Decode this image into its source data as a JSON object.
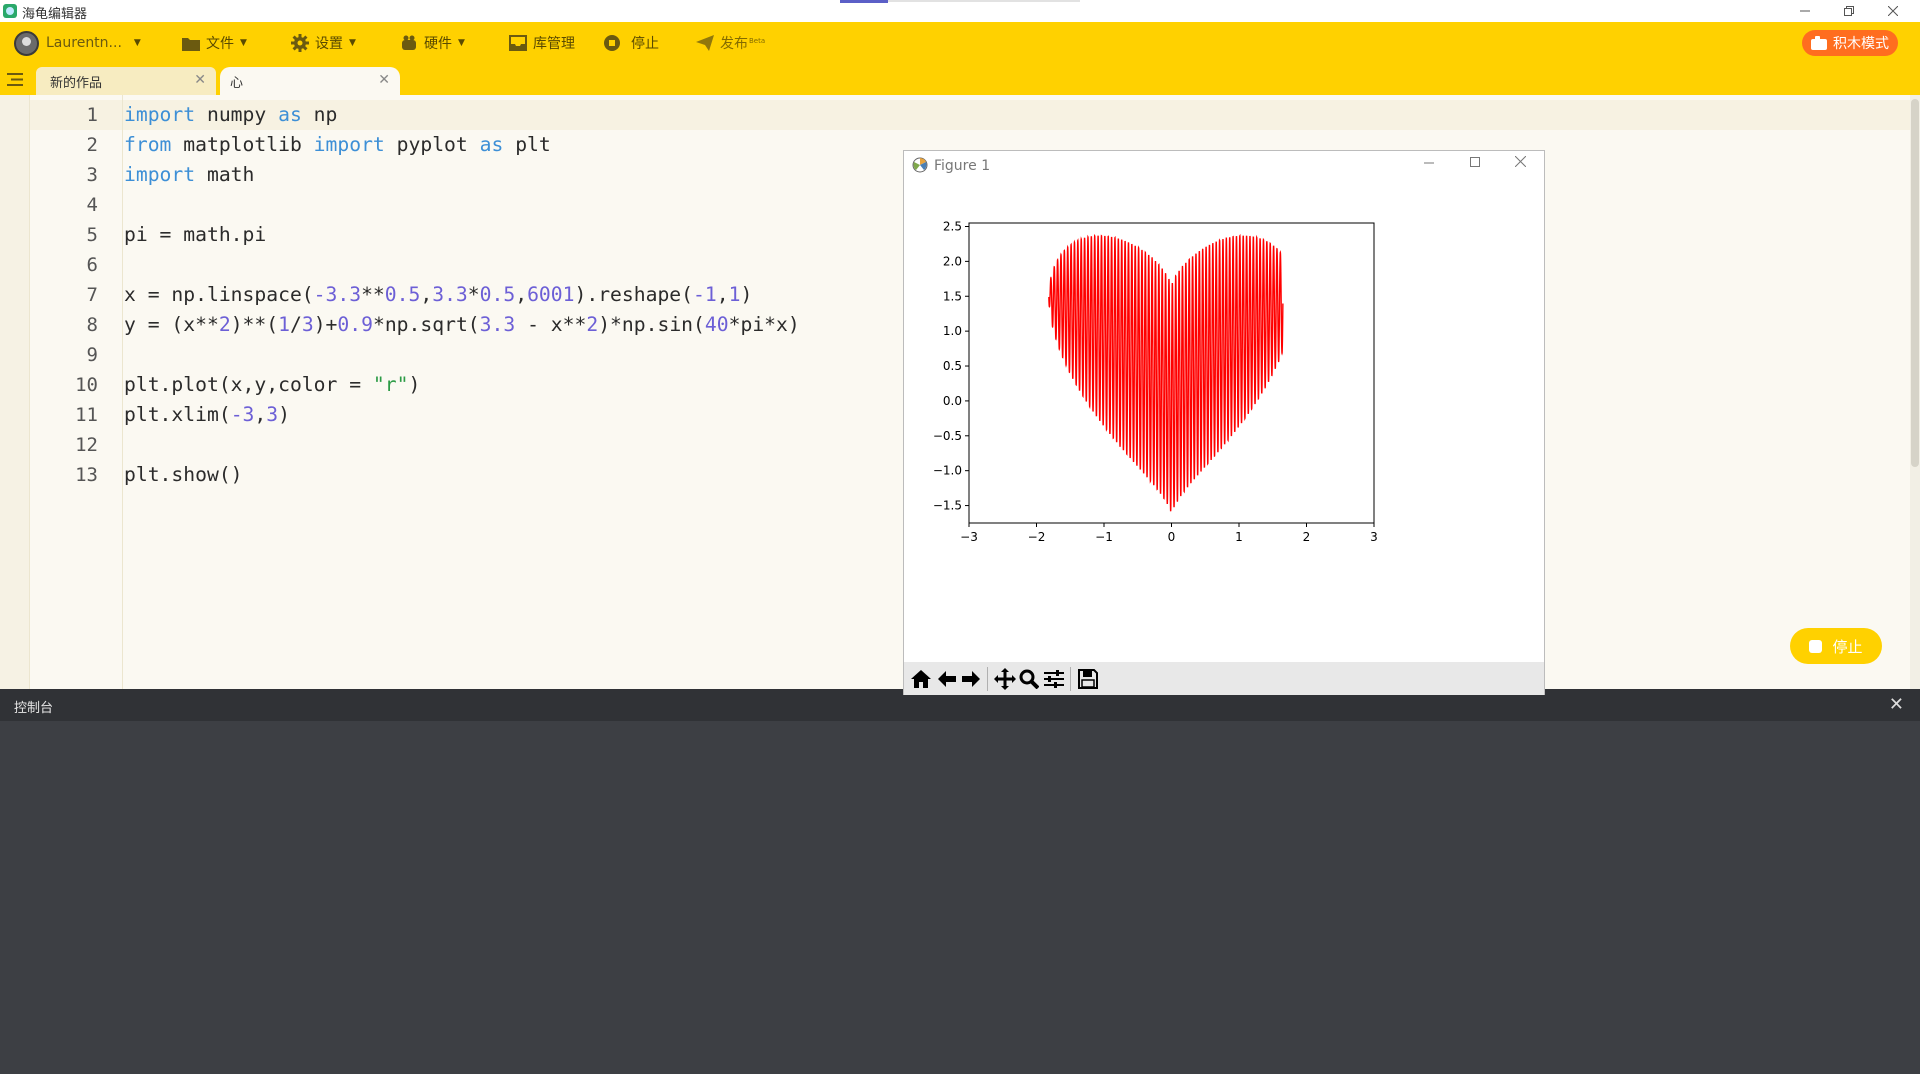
{
  "window": {
    "title": "海龟编辑器",
    "controls": [
      "minimize",
      "restore",
      "close"
    ]
  },
  "toolbar": {
    "user_name": "Laurentn...",
    "file_label": "文件",
    "settings_label": "设置",
    "hardware_label": "硬件",
    "library_label": "库管理",
    "stop_label": "停止",
    "publish_label": "发布",
    "publish_badge": "Beta",
    "block_mode_label": "积木模式",
    "accent_color": "#ffd100",
    "block_mode_color": "#ff6d1f"
  },
  "tabs": [
    {
      "label": "新的作品"
    },
    {
      "label": "心"
    }
  ],
  "editor": {
    "line_numbers": [
      "1",
      "2",
      "3",
      "4",
      "5",
      "6",
      "7",
      "8",
      "9",
      "10",
      "11",
      "12",
      "13"
    ],
    "lines": [
      [
        {
          "t": "import",
          "c": "kw"
        },
        {
          "t": " numpy "
        },
        {
          "t": "as",
          "c": "kw"
        },
        {
          "t": " np"
        }
      ],
      [
        {
          "t": "from",
          "c": "kw"
        },
        {
          "t": " matplotlib "
        },
        {
          "t": "import",
          "c": "kw"
        },
        {
          "t": " pyplot "
        },
        {
          "t": "as",
          "c": "kw"
        },
        {
          "t": " plt"
        }
      ],
      [
        {
          "t": "import",
          "c": "kw"
        },
        {
          "t": " math"
        }
      ],
      [],
      [
        {
          "t": "pi = math.pi"
        }
      ],
      [],
      [
        {
          "t": "x = np.linspace("
        },
        {
          "t": "-3.3",
          "c": "num"
        },
        {
          "t": "**"
        },
        {
          "t": "0.5",
          "c": "num"
        },
        {
          "t": ","
        },
        {
          "t": "3.3",
          "c": "num"
        },
        {
          "t": "*"
        },
        {
          "t": "0.5",
          "c": "num"
        },
        {
          "t": ","
        },
        {
          "t": "6001",
          "c": "num"
        },
        {
          "t": ").reshape("
        },
        {
          "t": "-1",
          "c": "num"
        },
        {
          "t": ","
        },
        {
          "t": "1",
          "c": "num"
        },
        {
          "t": ")"
        }
      ],
      [
        {
          "t": "y = (x**"
        },
        {
          "t": "2",
          "c": "num"
        },
        {
          "t": ")**("
        },
        {
          "t": "1",
          "c": "num"
        },
        {
          "t": "/"
        },
        {
          "t": "3",
          "c": "num"
        },
        {
          "t": ")+"
        },
        {
          "t": "0.9",
          "c": "num"
        },
        {
          "t": "*np.sqrt("
        },
        {
          "t": "3.3",
          "c": "num"
        },
        {
          "t": " - x**"
        },
        {
          "t": "2",
          "c": "num"
        },
        {
          "t": ")*np.sin("
        },
        {
          "t": "40",
          "c": "num"
        },
        {
          "t": "*pi*x)"
        }
      ],
      [],
      [
        {
          "t": "plt.plot(x,y,color = "
        },
        {
          "t": "\"r\"",
          "c": "str"
        },
        {
          "t": ")"
        }
      ],
      [
        {
          "t": "plt.xlim("
        },
        {
          "t": "-3",
          "c": "num"
        },
        {
          "t": ","
        },
        {
          "t": "3",
          "c": "num"
        },
        {
          "t": ")"
        }
      ],
      [],
      [
        {
          "t": "plt.show()"
        }
      ]
    ]
  },
  "run_button_label": "停止",
  "console": {
    "title": "控制台",
    "close_icon": "close-icon"
  },
  "figure": {
    "title": "Figure 1",
    "toolbar_icons": [
      "home-icon",
      "back-arrow-icon",
      "forward-arrow-icon",
      "pan-icon",
      "zoom-icon",
      "configure-subplots-icon",
      "save-icon"
    ]
  },
  "chart_data": {
    "type": "line",
    "title": "",
    "xlabel": "",
    "ylabel": "",
    "xlim": [
      -3,
      3
    ],
    "ylim": [
      -1.75,
      2.55
    ],
    "x_ticks": [
      "−3",
      "−2",
      "−1",
      "0",
      "1",
      "2",
      "3"
    ],
    "y_ticks": [
      "2.5",
      "2.0",
      "1.5",
      "1.0",
      "0.5",
      "0.0",
      "−0.5",
      "−1.0",
      "−1.5"
    ],
    "grid": false,
    "series": [
      {
        "function": "y = (x**2)**(1/3) + 0.9*sqrt(3.3 - x**2)*sin(40*pi*x)",
        "x_range": [
          -1.8166,
          1.8166
        ],
        "num_points": 6001,
        "color": "#ff0000"
      }
    ]
  }
}
